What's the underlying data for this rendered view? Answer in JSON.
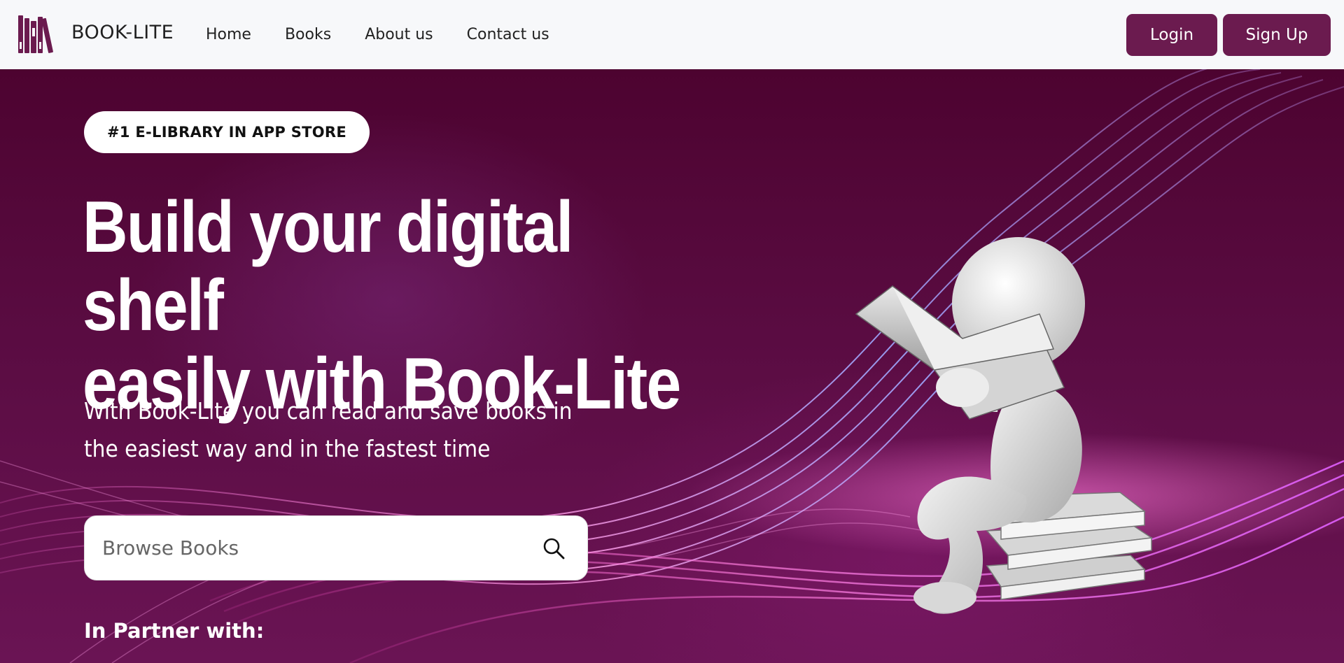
{
  "brand": {
    "name": "BOOK-LITE",
    "logo_icon": "bookshelf-icon",
    "logo_color": "#6b1b4f"
  },
  "nav": {
    "links": [
      {
        "label": "Home"
      },
      {
        "label": "Books"
      },
      {
        "label": "About us"
      },
      {
        "label": "Contact us"
      }
    ],
    "login_label": "Login",
    "signup_label": "Sign Up",
    "button_color": "#6b1b4f"
  },
  "hero": {
    "badge": "#1 E-LIBRARY IN APP STORE",
    "headline_line1": "Build your digital shelf",
    "headline_line2": "easily with Book-Lite",
    "subtext_line1": "With Book-Lite you can read and save books in",
    "subtext_line2": "the easiest way and in the fastest time",
    "search": {
      "placeholder": "Browse Books",
      "value": "",
      "icon": "search-icon"
    },
    "partner_label": "In Partner with:",
    "background_color": "#530636",
    "illustration": "figure-reading-book-illustration"
  }
}
